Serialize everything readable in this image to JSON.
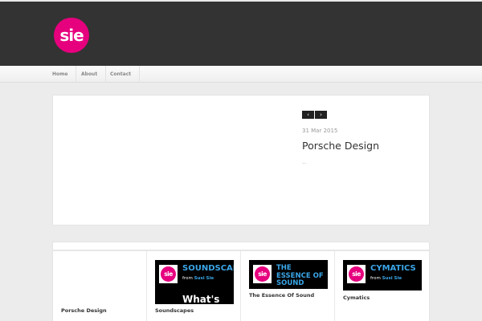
{
  "header": {
    "logo_text": "sie"
  },
  "nav": {
    "items": [
      {
        "label": "Home"
      },
      {
        "label": "About"
      },
      {
        "label": "Contact"
      }
    ]
  },
  "featured": {
    "prev_label": "‹",
    "next_label": "›",
    "date": "31 Mar 2015",
    "title": "Porsche Design",
    "more": "..."
  },
  "grid": {
    "items": [
      {
        "caption": "Porsche Design"
      },
      {
        "caption": "Soundscapes",
        "thumb_logo": "sie",
        "thumb_title": "SOUNDSCAP",
        "thumb_from": "from",
        "thumb_author": "Susi Sie",
        "thumb_overflow": "What's"
      },
      {
        "caption": "The Essence Of Sound",
        "thumb_logo": "sie",
        "thumb_title": "THE ESSENCE OF SOUND"
      },
      {
        "caption": "Cymatics",
        "thumb_logo": "sie",
        "thumb_title": "CYMATICS",
        "thumb_from": "from",
        "thumb_author": "Susi Sie"
      }
    ]
  },
  "colors": {
    "brand": "#e6007e",
    "accent": "#3aa6e8",
    "header_bg": "#333333"
  }
}
